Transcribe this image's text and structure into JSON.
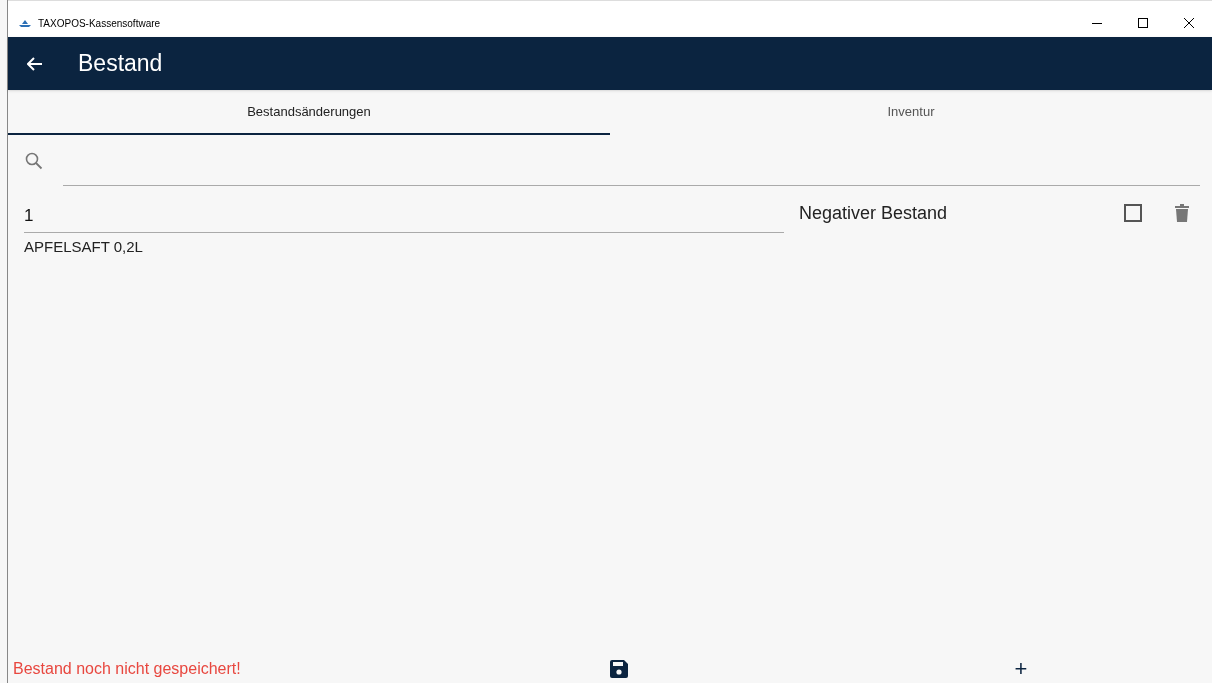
{
  "window": {
    "title": "TAXOPOS-Kassensoftware"
  },
  "header": {
    "title": "Bestand"
  },
  "tabs": [
    {
      "label": "Bestandsänderungen",
      "selected": true
    },
    {
      "label": "Inventur",
      "selected": false
    }
  ],
  "entries": [
    {
      "quantity": "1",
      "name": "APFELSAFT 0,2L",
      "option_label": "Negativer Bestand",
      "checked": false
    }
  ],
  "status_bar": {
    "message": "Bestand noch nicht gespeichert!",
    "add_label": "+"
  }
}
